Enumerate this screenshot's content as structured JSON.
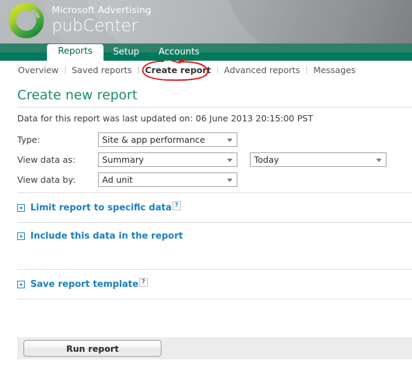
{
  "brand": {
    "line1": "Microsoft Advertising",
    "line2": "pubCenter",
    "logo_icon": "green-ring-logo-icon"
  },
  "primary_nav": {
    "tabs": [
      {
        "label": "Reports",
        "active": true
      },
      {
        "label": "Setup",
        "active": false
      },
      {
        "label": "Accounts",
        "active": false
      }
    ]
  },
  "sub_nav": {
    "items": [
      {
        "label": "Overview",
        "active": false
      },
      {
        "label": "Saved reports",
        "active": false
      },
      {
        "label": "Create report",
        "active": true
      },
      {
        "label": "Advanced reports",
        "active": false
      },
      {
        "label": "Messages",
        "active": false
      }
    ]
  },
  "annotation": {
    "shape": "hand-drawn-ellipse",
    "color": "#e01b1b",
    "target": "Create report"
  },
  "page": {
    "title": "Create new report",
    "subtitle": "Data for this report was last updated on: 06 June 2013 20:15:00 PST"
  },
  "form": {
    "rows": [
      {
        "label": "Type:",
        "value": "Site & app performance",
        "name": "report-type-select"
      },
      {
        "label": "View data as:",
        "value": "Summary",
        "name": "view-data-as-select",
        "value2": "Today",
        "name2": "date-range-select"
      },
      {
        "label": "View data by:",
        "value": "Ad unit",
        "name": "view-data-by-select"
      }
    ]
  },
  "sections": [
    {
      "label": "Limit report to specific data",
      "expander_icon": "plus-box-icon",
      "help_icon": "question-mark-icon",
      "help_label": "?",
      "has_help": true
    },
    {
      "label": "Include this data in the report",
      "expander_icon": "plus-box-icon",
      "help_label": "?",
      "has_help": false
    },
    {
      "label": "Save report template",
      "expander_icon": "plus-box-icon",
      "help_icon": "question-mark-icon",
      "help_label": "?",
      "has_help": true
    }
  ],
  "footer": {
    "run_label": "Run report"
  },
  "colors": {
    "nav_green": "#007a5e",
    "nav_green_light": "#2d8169",
    "title_green": "#1a8a6c",
    "link_blue": "#1a7fc1",
    "annotation_red": "#e01b1b"
  }
}
